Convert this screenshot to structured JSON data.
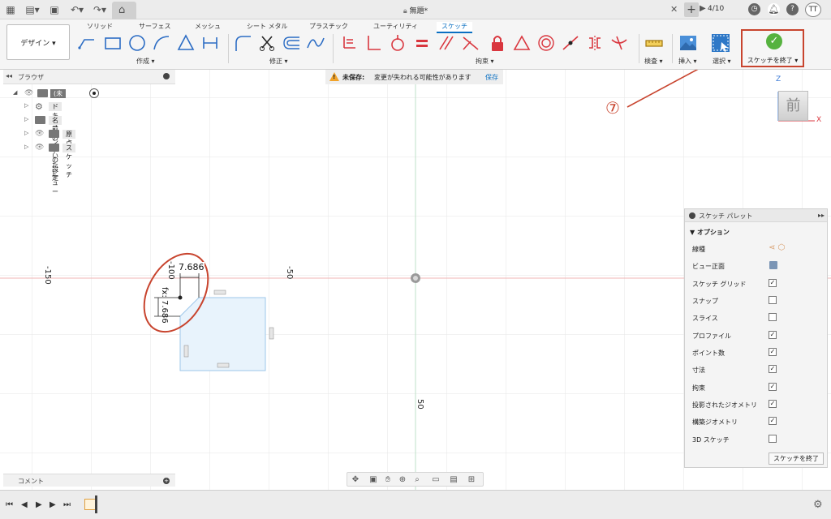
{
  "titlebar": {
    "doc_title": "無題*",
    "job_status": "4/10",
    "user_initials": "TT",
    "icons": [
      "grid-icon",
      "file-icon",
      "save-icon",
      "undo-icon",
      "redo-icon",
      "home-icon",
      "lock-icon",
      "close-icon",
      "plus-icon",
      "job-icon",
      "clock-icon",
      "bell-icon",
      "help-icon"
    ]
  },
  "ribbon": {
    "workspace": "デザイン ▾",
    "tabs": [
      "ソリッド",
      "サーフェス",
      "メッシュ",
      "シート メタル",
      "プラスチック",
      "ユーティリティ",
      "スケッチ"
    ],
    "active_tab": "スケッチ",
    "groups": {
      "create": "作成 ▾",
      "modify": "修正 ▾",
      "constraints": "拘束 ▾",
      "inspect": "検査 ▾",
      "insert": "挿入 ▾",
      "select": "選択 ▾"
    },
    "finish": "スケッチを終了 ▾"
  },
  "browser": {
    "title": "ブラウザ",
    "root": "(未保存)",
    "items": [
      "ドキュメントの設定",
      "名前の付いたビュー",
      "原点",
      "スケッチ"
    ]
  },
  "banner": {
    "label": "未保存:",
    "message": "変更が失われる可能性があります",
    "action": "保存"
  },
  "canvas": {
    "axis_labels": [
      "-150",
      "-100",
      "-50",
      "50"
    ],
    "dimension_h": "7.686",
    "dimension_v": "fx: 7.686",
    "viewcube": "前",
    "axis_z": "Z",
    "axis_x": "X"
  },
  "palette": {
    "title": "スケッチ パレット",
    "section": "オプション",
    "rows": [
      {
        "label": "線種",
        "type": "icon"
      },
      {
        "label": "ビュー正面",
        "type": "icon"
      },
      {
        "label": "スケッチ グリッド",
        "checked": true
      },
      {
        "label": "スナップ",
        "checked": false
      },
      {
        "label": "スライス",
        "checked": false
      },
      {
        "label": "プロファイル",
        "checked": true
      },
      {
        "label": "ポイント数",
        "checked": true
      },
      {
        "label": "寸法",
        "checked": true
      },
      {
        "label": "拘束",
        "checked": true
      },
      {
        "label": "投影されたジオメトリ",
        "checked": true
      },
      {
        "label": "構築ジオメトリ",
        "checked": true
      },
      {
        "label": "3D スケッチ",
        "checked": false
      }
    ],
    "finish_button": "スケッチを終了"
  },
  "comments": {
    "label": "コメント"
  },
  "annotation": {
    "number": "⑦"
  },
  "colors": {
    "accent": "#0a6fc2",
    "highlight": "#c8442e",
    "finish_green": "#56b23f",
    "constraint_red": "#d9363e",
    "sketch_fill": "#e8f3fc"
  }
}
